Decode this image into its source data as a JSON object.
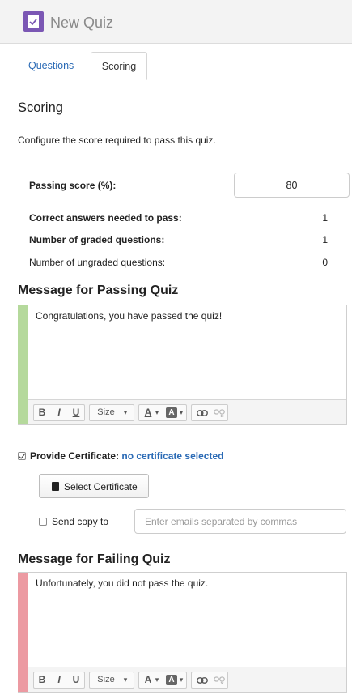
{
  "window": {
    "title": "New Quiz"
  },
  "tabs": [
    {
      "label": "Questions",
      "active": false
    },
    {
      "label": "Scoring",
      "active": true
    }
  ],
  "scoring": {
    "heading": "Scoring",
    "description": "Configure the score required to pass this quiz.",
    "passing_score": {
      "label": "Passing score (%):",
      "value": "80"
    },
    "rows": [
      {
        "label": "Correct answers needed to pass:",
        "value": "1"
      },
      {
        "label": "Number of graded questions:",
        "value": "1"
      },
      {
        "label": "Number of ungraded questions:",
        "value": "0"
      }
    ]
  },
  "passing": {
    "heading": "Message for Passing Quiz",
    "message": "Congratulations, you have passed the quiz!",
    "accent_color": "#b5d99c"
  },
  "failing": {
    "heading": "Message for Failing Quiz",
    "message": "Unfortunately, you did not pass the quiz.",
    "accent_color": "#ec9aa2"
  },
  "toolbar": {
    "bold": "B",
    "italic": "I",
    "underline": "U",
    "size": "Size",
    "size_caret": "▾",
    "font_color": "A",
    "font_color_caret": "▾",
    "bg_color": "A",
    "bg_color_caret": "▾",
    "link_icon": "link-icon",
    "unlink_icon": "unlink-icon"
  },
  "certificate": {
    "checked": true,
    "label": "Provide Certificate:",
    "status": "no certificate selected",
    "status_color": "#2a6ab5",
    "button_label": "Select Certificate",
    "button_icon": "certificate-icon"
  },
  "send_copy": {
    "checked": false,
    "label": "Send copy to",
    "placeholder": "Enter emails separated by commas",
    "value": ""
  }
}
